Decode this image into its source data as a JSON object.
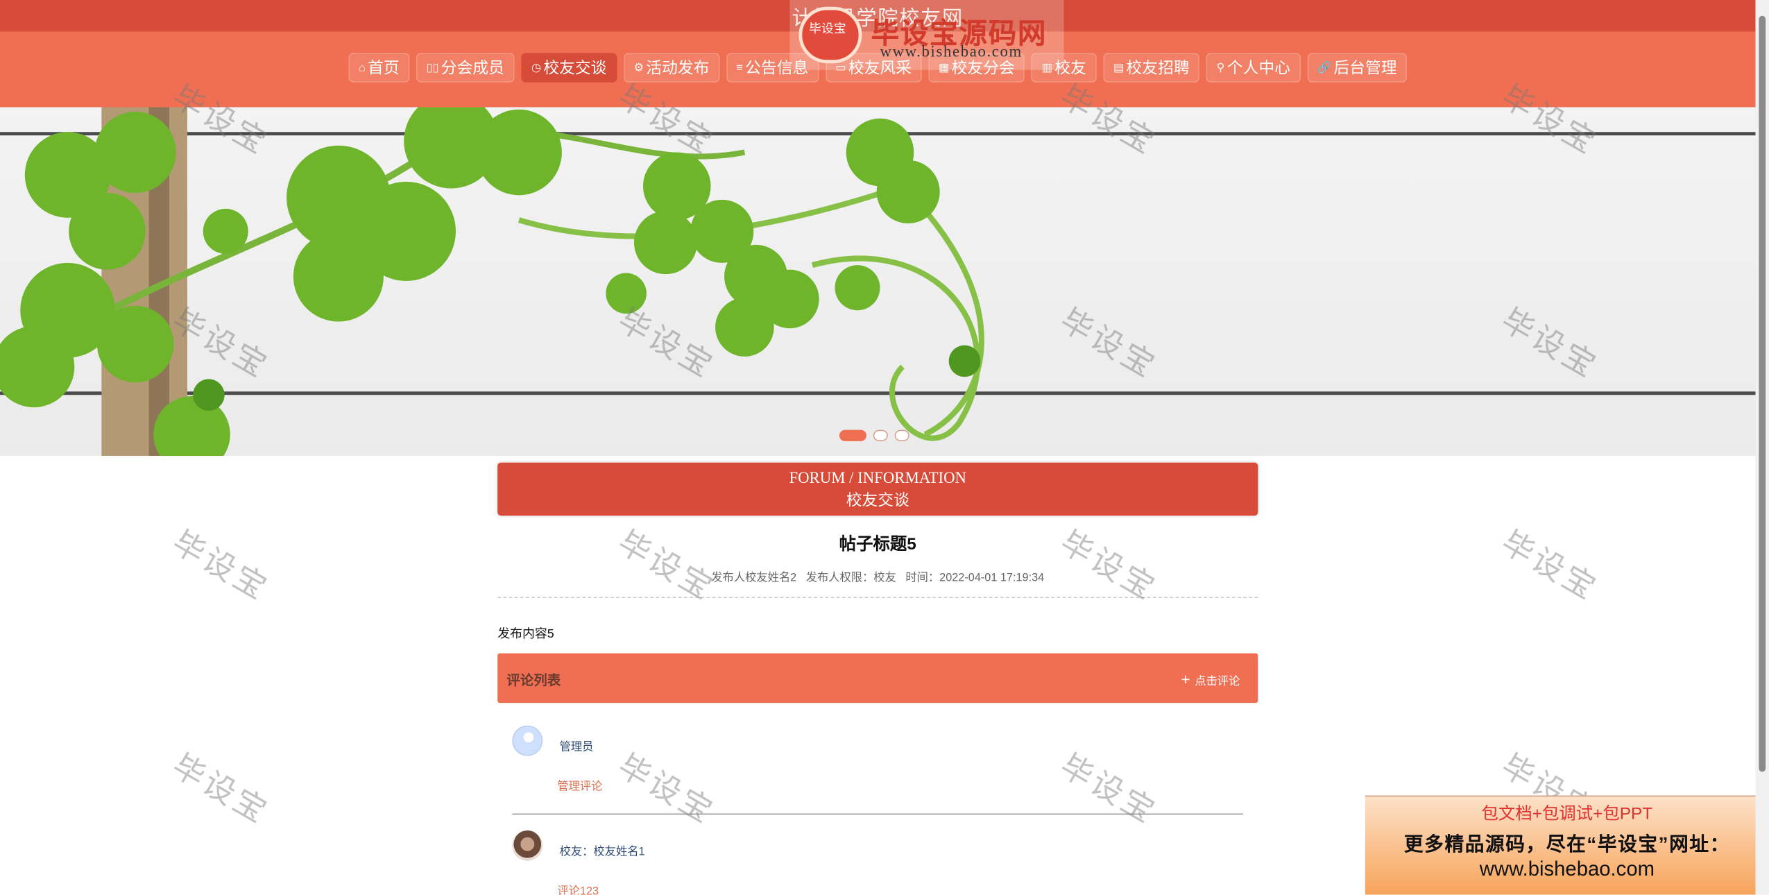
{
  "site": {
    "title": "计算机学院校友网"
  },
  "nav": {
    "items": [
      {
        "icon": "⌂",
        "label": "首页"
      },
      {
        "icon": "▯▯",
        "label": "分会成员"
      },
      {
        "icon": "◷",
        "label": "校友交谈"
      },
      {
        "icon": "⚙",
        "label": "活动发布"
      },
      {
        "icon": "≡",
        "label": "公告信息"
      },
      {
        "icon": "▭",
        "label": "校友风采"
      },
      {
        "icon": "▦",
        "label": "校友分会"
      },
      {
        "icon": "▥",
        "label": "校友"
      },
      {
        "icon": "▤",
        "label": "校友招聘"
      },
      {
        "icon": "⚲",
        "label": "个人中心"
      },
      {
        "icon": "🔗",
        "label": "后台管理"
      }
    ],
    "active_index": 2
  },
  "logo": {
    "badge": "毕设宝",
    "name": "毕设宝源码网",
    "url": "www.bishebao.com"
  },
  "section": {
    "en": "FORUM / INFORMATION",
    "cn": "校友交谈"
  },
  "post": {
    "title": "帖子标题5",
    "meta": "发布人校友姓名2   发布人权限：校友   时间：2022-04-01 17:19:34",
    "body": "发布内容5"
  },
  "comments": {
    "title": "评论列表",
    "button": "点击评论",
    "items": [
      {
        "name": "管理员",
        "text": "管理评论"
      },
      {
        "name": "校友：校友姓名1",
        "text": "评论123"
      }
    ]
  },
  "watermark": "毕设宝",
  "promo": {
    "line1": "包文档+包调试+包PPT",
    "line2": "更多精品源码，尽在“毕设宝”网址：",
    "line3": "www.bishebao.com"
  },
  "colors": {
    "primary": "#d74c38",
    "nav_bg": "#f06f52",
    "accent": "#f06f52"
  }
}
